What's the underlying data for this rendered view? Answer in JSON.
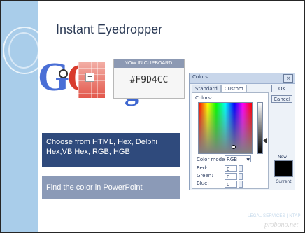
{
  "slide": {
    "title": "Instant Eyedropper",
    "clipboard": {
      "header": "NOW IN CLIPBOARD:",
      "value": "#F9D4CC"
    },
    "logo_text": {
      "g1": "G",
      "o1": "O",
      "g2": "g"
    },
    "boxes": [
      {
        "text": "Choose from HTML, Hex, Delphi Hex,VB Hex, RGB, HGB"
      },
      {
        "text": "Find the color in PowerPoint"
      }
    ],
    "footer": {
      "line1": "LEGAL SERVICES | NTAP",
      "line2": "probono.net"
    }
  },
  "dialog": {
    "title": "Colors",
    "tabs": [
      "Standard",
      "Custom"
    ],
    "active_tab": "Custom",
    "colors_label": "Colors:",
    "color_model_label": "Color model:",
    "color_model_value": "RGB",
    "channels": [
      {
        "label": "Red:",
        "value": "0"
      },
      {
        "label": "Green:",
        "value": "0"
      },
      {
        "label": "Blue:",
        "value": "0"
      }
    ],
    "buttons": {
      "ok": "OK",
      "cancel": "Cancel"
    },
    "new_label": "New",
    "current_label": "Current"
  }
}
